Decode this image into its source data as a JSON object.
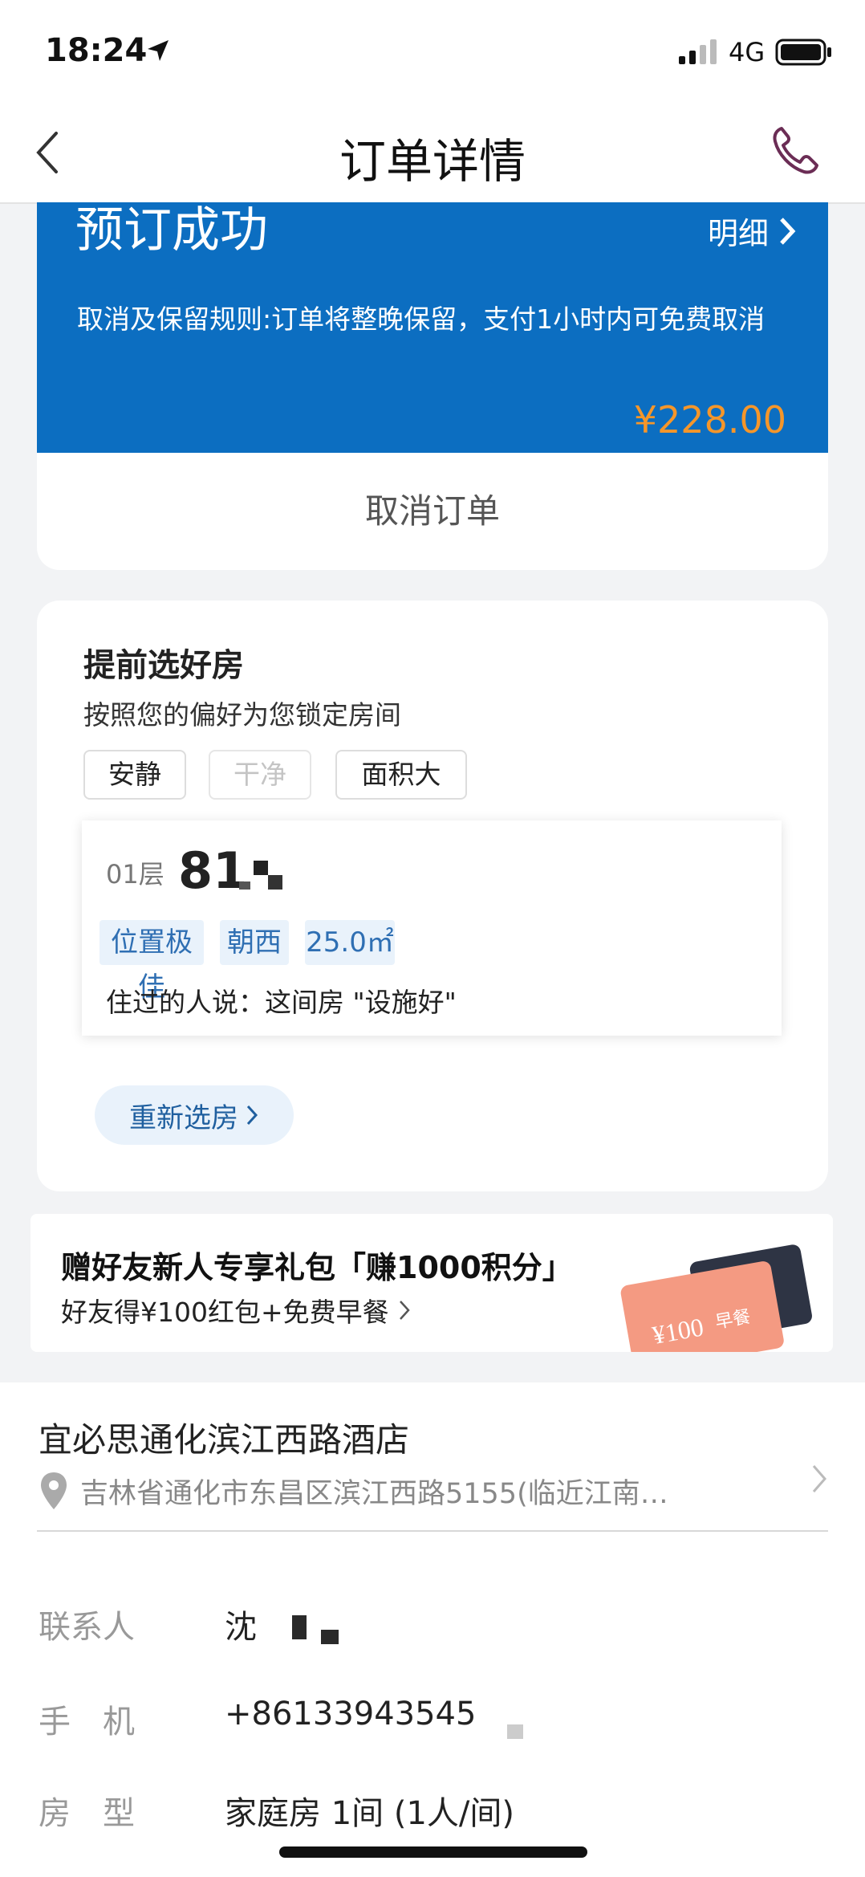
{
  "status_bar": {
    "time": "18:24",
    "network": "4G"
  },
  "nav": {
    "title": "订单详情"
  },
  "order": {
    "status": "预订成功",
    "detail_label": "明细",
    "cancel_rule": "取消及保留规则:订单将整晚保留，支付1小时内可免费取消",
    "price": "¥228.00",
    "cancel_button": "取消订单"
  },
  "room_select": {
    "title": "提前选好房",
    "subtitle": "按照您的偏好为您锁定房间",
    "preferences": [
      "安静",
      "干净",
      "面积大"
    ],
    "floor": "01层",
    "room_number": "81",
    "tags": [
      "位置极佳",
      "朝西",
      "25.0㎡"
    ],
    "review": "住过的人说：这间房 \"设施好\"",
    "rechoose_button": "重新选房"
  },
  "promo": {
    "title": "赠好友新人专享礼包「赚1000积分」",
    "subtitle": "好友得¥100红包+免费早餐",
    "card_amount": "¥100",
    "card_label": "早餐"
  },
  "hotel": {
    "name": "宜必思通化滨江西路酒店",
    "address": "吉林省通化市东昌区滨江西路5155(临近江南…"
  },
  "guest": {
    "contact_label": "联系人",
    "contact_value": "沈",
    "phone_label": "手　机",
    "phone_value": "+86133943545",
    "room_type_label": "房　型",
    "room_type_value": "家庭房  1间 (1人/间)"
  },
  "colors": {
    "primary_blue": "#0c6ec1",
    "price_orange": "#f5962a",
    "tag_bg": "#e9f2fb"
  }
}
